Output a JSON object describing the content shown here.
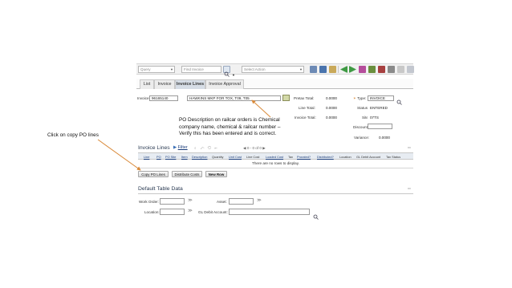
{
  "toolbar": {
    "query_placeholder": "Query",
    "find_placeholder": "Find Invoice",
    "action_placeholder": "Select Action"
  },
  "tabs": [
    {
      "label": "List"
    },
    {
      "label": "Invoice"
    },
    {
      "label": "Invoice Lines"
    },
    {
      "label": "Invoice Approval"
    }
  ],
  "header": {
    "invoice_label": "Invoice:",
    "invoice_value": "96165140",
    "description_value": "HAWKINS MKP FOR TOX, T09, T05",
    "pretax_label": "Pretax Total:",
    "pretax_value": "0.0000",
    "line_label": "Line Total:",
    "line_value": "0.0000",
    "invtotal_label": "Invoice Total:",
    "invtotal_value": "0.0000",
    "type_label": "Type:",
    "type_value": "INVOICE",
    "status_label": "Status:",
    "status_value": "ENTERED",
    "site_label": "Site:",
    "site_value": "07TS",
    "discount_label": "Discount:",
    "variance_label": "Variance:",
    "variance_value": "0.0000"
  },
  "invoice_lines": {
    "title": "Invoice Lines",
    "filter_label": "Filter",
    "pager": "0 - 0 of 0",
    "columns": [
      "Line",
      "PO",
      "PO Site",
      "Item",
      "Description",
      "Quantity",
      "Unit Cost",
      "Line Cost",
      "Loaded Cost",
      "Tax",
      "Prorated?",
      "Distributed?",
      "Location",
      "GL Debit Account",
      "Tax Status"
    ],
    "empty_message": "There are no rows to display.",
    "buttons": [
      "Copy PO Lines",
      "Distribute Costs",
      "New Row"
    ]
  },
  "defaults": {
    "title": "Default Table Data",
    "work_order_label": "Work Order:",
    "asset_label": "Asset:",
    "location_label": "Location:",
    "gl_label": "GL Debit Account:"
  },
  "annotations": {
    "left": "Click on copy PO lines",
    "middle": "PO Description on railcar orders is Chemical company name, chemical & railcar number – Verify this has been entered and is correct."
  },
  "colors": {
    "active_tab": "#d6dde6",
    "arrow": "#d98a3a",
    "section_title": "#2a3a52",
    "link": "#1a3c7a"
  }
}
